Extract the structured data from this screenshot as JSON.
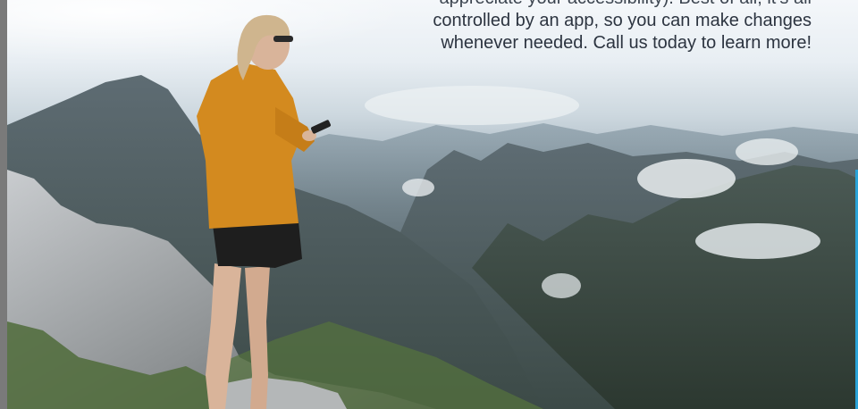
{
  "hero": {
    "caption_lines": [
      "appreciate your accessibility). Best of all, it’s all",
      "controlled by an app, so you can make changes",
      "whenever needed. Call us today to learn more!"
    ]
  },
  "colors": {
    "jacket": "#d38a1f",
    "shorts": "#1e1e1e",
    "sky": "#eef2f6",
    "accent_edge": "#2aa3d8"
  }
}
